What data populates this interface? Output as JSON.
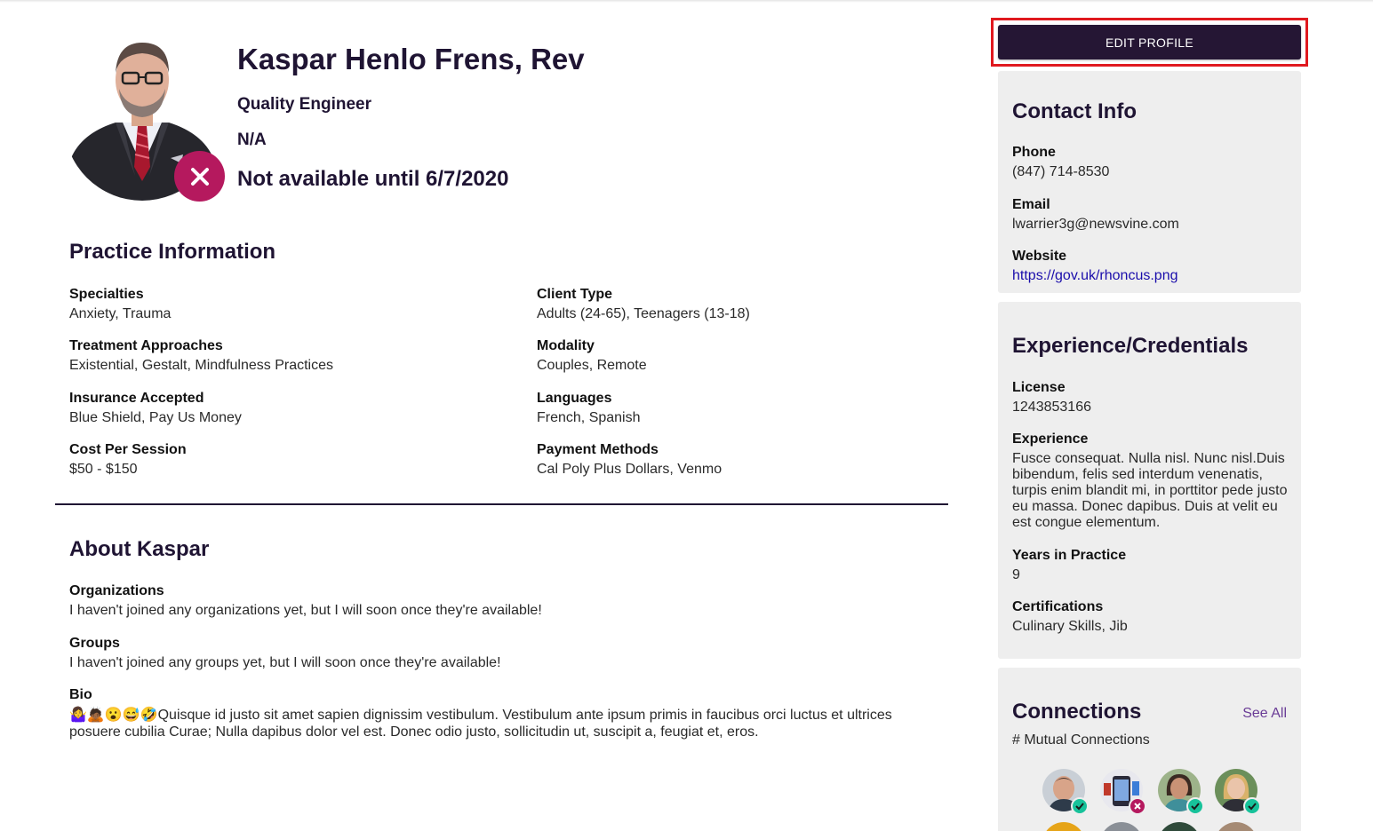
{
  "profile": {
    "name": "Kaspar Henlo Frens, Rev",
    "role": "Quality Engineer",
    "affiliation": "N/A",
    "availability": "Not available until 6/7/2020",
    "status_icon": "close-icon",
    "status_color": "#b5195e"
  },
  "practice": {
    "title": "Practice Information",
    "fields": [
      {
        "label": "Specialties",
        "value": "Anxiety, Trauma"
      },
      {
        "label": "Treatment Approaches",
        "value": "Existential, Gestalt, Mindfulness Practices"
      },
      {
        "label": "Insurance Accepted",
        "value": "Blue Shield, Pay Us Money"
      },
      {
        "label": "Cost Per Session",
        "value": "$50 - $150"
      },
      {
        "label": "Client Type",
        "value": "Adults (24-65), Teenagers (13-18)"
      },
      {
        "label": "Modality",
        "value": "Couples, Remote"
      },
      {
        "label": "Languages",
        "value": "French, Spanish"
      },
      {
        "label": "Payment Methods",
        "value": "Cal Poly Plus Dollars, Venmo"
      }
    ]
  },
  "about": {
    "title": "About Kaspar",
    "organizations": {
      "label": "Organizations",
      "value": "I haven't joined any organizations yet, but I will soon once they're available!"
    },
    "groups": {
      "label": "Groups",
      "value": "I haven't joined any groups yet, but I will soon once they're available!"
    },
    "bio": {
      "label": "Bio",
      "value": "🤷‍♀️🙇🏾😮😅🤣Quisque id justo sit amet sapien dignissim vestibulum. Vestibulum ante ipsum primis in faucibus orci luctus et ultrices posuere cubilia Curae; Nulla dapibus dolor vel est. Donec odio justo, sollicitudin ut, suscipit a, feugiat et, eros."
    }
  },
  "sidebar": {
    "edit_label": "EDIT PROFILE",
    "contact": {
      "title": "Contact Info",
      "phone": {
        "label": "Phone",
        "value": "(847) 714-8530"
      },
      "email": {
        "label": "Email",
        "value": "lwarrier3g@newsvine.com"
      },
      "website": {
        "label": "Website",
        "value": "https://gov.uk/rhoncus.png"
      }
    },
    "experience": {
      "title": "Experience/Credentials",
      "license": {
        "label": "License",
        "value": "1243853166"
      },
      "experience": {
        "label": "Experience",
        "value": "Fusce consequat. Nulla nisl. Nunc nisl.Duis bibendum, felis sed interdum venenatis, turpis enim blandit mi, in porttitor pede justo eu massa. Donec dapibus. Duis at velit eu est congue elementum."
      },
      "years": {
        "label": "Years in Practice",
        "value": "9"
      },
      "certifications": {
        "label": "Certifications",
        "value": "Culinary Skills, Jib"
      }
    },
    "connections": {
      "title": "Connections",
      "see_all": "See All",
      "mutual": "# Mutual Connections",
      "people": [
        {
          "status": "connected",
          "badge_icon": "check-icon"
        },
        {
          "status": "unavailable",
          "badge_icon": "close-icon"
        },
        {
          "status": "connected",
          "badge_icon": "check-icon"
        },
        {
          "status": "connected",
          "badge_icon": "check-icon"
        }
      ]
    }
  },
  "colors": {
    "brand_dark": "#251634",
    "accent_magenta": "#b5195e",
    "accent_green": "#17c29a",
    "highlight_red": "#e0191f",
    "card_bg": "#eeeeee",
    "link": "#1a0dab"
  }
}
